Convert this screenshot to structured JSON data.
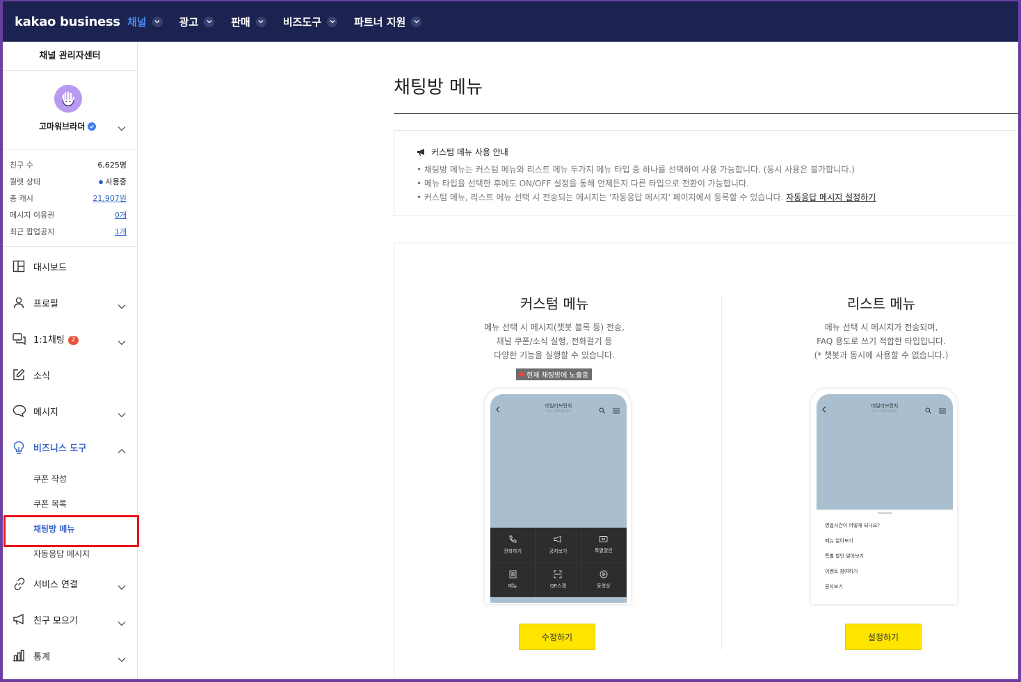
{
  "topnav": {
    "logo": "kakao business",
    "items": [
      {
        "label": "채널",
        "active": true
      },
      {
        "label": "광고"
      },
      {
        "label": "판매"
      },
      {
        "label": "비즈도구"
      },
      {
        "label": "파트너 지원"
      }
    ]
  },
  "sidebar": {
    "title": "채널 관리자센터",
    "profile": {
      "name": "고마워브라더",
      "avatar_icon": "hand-avatar-icon"
    },
    "stats": [
      {
        "label": "친구 수",
        "value": "6,625명"
      },
      {
        "label": "월렛 상태",
        "value": "사용중"
      },
      {
        "label": "총 캐시",
        "value": "21,907원"
      },
      {
        "label": "메시지 이용권",
        "value": "0개"
      },
      {
        "label": "최근 팝업공지",
        "value": "1개"
      }
    ],
    "menu": {
      "dashboard": "대시보드",
      "profile": "프로필",
      "chat": "1:1채팅",
      "chat_badge": "2",
      "news": "소식",
      "message": "메시지",
      "biz_tools": "비즈니스 도구",
      "coupon_create": "쿠폰 작성",
      "coupon_list": "쿠폰 목록",
      "chatroom_menu": "채팅방 메뉴",
      "auto_reply": "자동응답 메시지",
      "service_link": "서비스 연결",
      "friend_gather": "친구 모으기",
      "stats": "통계"
    }
  },
  "main": {
    "title": "채팅방 메뉴",
    "notice": {
      "heading": "커스텀 메뉴 사용 안내",
      "lines": [
        "• 채팅방 메뉴는 커스텀 메뉴와 리스트 메뉴 두가지 메뉴 타입 중 하나를 선택하여 사용 가능합니다. (동시 사용은 불가합니다.)",
        "• 메뉴 타입을 선택한 후에도 ON/OFF 설정을 통해 언제든지 다른 타입으로 전환이 가능합니다.",
        "• 커스텀 메뉴, 리스트 메뉴 선택 시 전송되는 메시지는 '자동응답 메시지' 페이지에서 등록할 수 있습니다."
      ],
      "link": "자동응답 메시지 설정하기"
    },
    "custom": {
      "title": "커스텀 메뉴",
      "desc": [
        "메뉴 선택 시 메시지(챗봇 블록 등) 전송,",
        "채널 쿠폰/소식 실행, 전화걸기 등",
        "다양한 기능을 실행할 수 있습니다."
      ],
      "live_badge": "현재 채팅방에 노출중",
      "phone_name": "데일리브런치",
      "phone_sub": "031-765-8202",
      "grid": [
        "전화하기",
        "공지보기",
        "특별할인",
        "메뉴",
        "QR스캔",
        "동영상"
      ],
      "button": "수정하기"
    },
    "list": {
      "title": "리스트 메뉴",
      "desc": [
        "메뉴 선택 시 메시지가 전송되며,",
        "FAQ 용도로 쓰기 적합한 타입입니다.",
        "(* 챗봇과 동시에 사용할 수 없습니다.)"
      ],
      "phone_name": "데일리브런치",
      "phone_sub": "031-765-8202",
      "items": [
        "영업시간이 어떻게 되나요?",
        "메뉴 알아보기",
        "특별 할인 알아보기",
        "이벤트 참여하기",
        "공지보기"
      ],
      "button": "설정하기"
    }
  },
  "colors": {
    "nav_bg": "#1c2350",
    "accent": "#3562c9",
    "button": "#fee500",
    "highlight": "#e8121a"
  }
}
